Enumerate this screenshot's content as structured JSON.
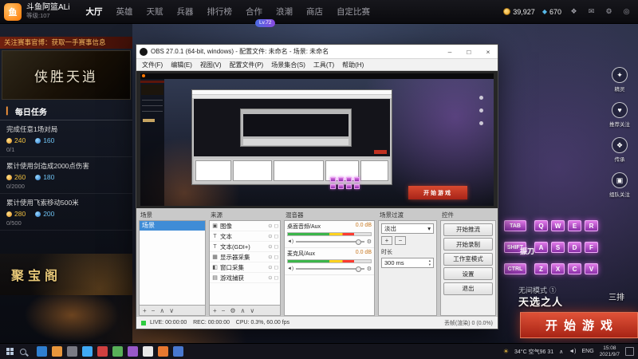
{
  "topbar": {
    "logo": "鱼",
    "username": "斗鱼阿篮ALi",
    "level": "等级:107",
    "badge": "Lv.72",
    "nav": [
      {
        "label": "大厅"
      },
      {
        "label": "英雄"
      },
      {
        "label": "天赋"
      },
      {
        "label": "兵器"
      },
      {
        "label": "排行榜"
      },
      {
        "label": "合作"
      },
      {
        "label": "浪潮"
      },
      {
        "label": "商店"
      },
      {
        "label": "自定比赛"
      }
    ],
    "gold": "39,927",
    "diamond": "670"
  },
  "sidebar": {
    "banner": "关注赛事官博：获取一手赛事信息",
    "poster": "侠胜天逍",
    "tasks_title": "每日任务",
    "tasks": [
      {
        "name": "完成任意1场对局",
        "gold": "240",
        "blue": "160",
        "progress": "0/1"
      },
      {
        "name": "累计使用剑造成2000点伤害",
        "gold": "260",
        "blue": "180",
        "progress": "0/2000"
      },
      {
        "name": "累计使用飞索移动500米",
        "gold": "280",
        "blue": "200",
        "progress": "0/500"
      }
    ],
    "treasure": "聚宝阁"
  },
  "obs": {
    "title": "OBS 27.0.1 (64-bit, windows) - 配置文件: 未命名 - 场景: 未命名",
    "menu": [
      "文件(F)",
      "编辑(E)",
      "视图(V)",
      "配置文件(P)",
      "场景集合(S)",
      "工具(T)",
      "帮助(H)"
    ],
    "scenes": {
      "title": "场景",
      "items": [
        "场景"
      ]
    },
    "sources": {
      "title": "来源",
      "items": [
        "图像",
        "文本",
        "文本(GDI+)",
        "显示器采集",
        "窗口采集",
        "游戏捕获"
      ]
    },
    "mixer": {
      "title": "混音器",
      "channels": [
        {
          "name": "桌面音频/Aux",
          "db": "0.0 dB"
        },
        {
          "name": "麦克风/Aux",
          "db": "0.0 dB"
        }
      ]
    },
    "transitions": {
      "title": "场景过渡",
      "selected": "淡出",
      "duration_label": "时长",
      "duration": "300 ms"
    },
    "controls": {
      "title": "控件",
      "buttons": [
        "开始推流",
        "开始录制",
        "工作室模式",
        "设置",
        "退出"
      ]
    },
    "status_left": "LIVE: 00:00:00    REC: 00:00:00    CPU: 0.3%, 60.00 fps",
    "status_right": "丢帧(渲染) 0 (0.0%)"
  },
  "game": {
    "side_icons": [
      {
        "label": "精灵",
        "glyph": "✦"
      },
      {
        "label": "推荐关注",
        "glyph": "♥"
      },
      {
        "label": "传承",
        "glyph": "❖"
      },
      {
        "label": "组队关注",
        "glyph": "▣"
      }
    ],
    "keys_left": [
      "TAB",
      "SHIFT",
      "CTRL"
    ],
    "keys_grid": [
      [
        "Q",
        "W",
        "E",
        "R"
      ],
      [
        "A",
        "S",
        "D",
        "F"
      ],
      [
        "Z",
        "X",
        "C",
        "V"
      ]
    ],
    "parry": "振刀",
    "mode": "无间模式 ①",
    "mode_sub": "天选之人",
    "team": "三排",
    "start": "开始游戏"
  },
  "taskbar": {
    "weather": "34°C 空气96 31",
    "lang": "ENG",
    "time": "15:08",
    "date": "2021/9/7"
  },
  "icons": {
    "minimize": "–",
    "maximize": "□",
    "close": "×",
    "mail": "✉",
    "gift": "❖",
    "settings": "⚙",
    "power": "◎",
    "gem": "◆",
    "eye": "⊙",
    "lock": "◻",
    "plus": "+",
    "minus": "−",
    "up": "∧",
    "down": "∨",
    "gear": "⚙",
    "dropdown": "▾",
    "spin_up": "▴",
    "spin_down": "▾",
    "speaker": "◄)",
    "sun": "☀",
    "tray_up": "∧",
    "tasks_marker": "▎"
  },
  "colors": {
    "accent_red": "#c0392b",
    "douyu_orange": "#ff7700",
    "key_purple": "#b44fd0",
    "selection_blue": "#3f8cd6",
    "gold": "#f0c040"
  }
}
